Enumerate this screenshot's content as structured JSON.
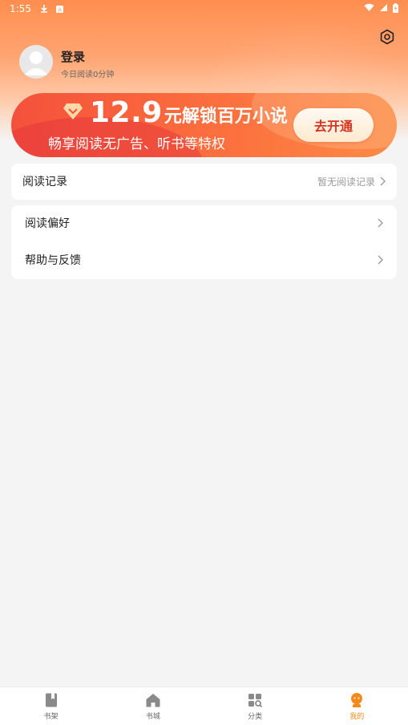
{
  "status_bar": {
    "time": "1:55",
    "icons": [
      "download-icon",
      "notification-icon",
      "wifi-icon",
      "signal-icon",
      "battery-icon"
    ]
  },
  "profile": {
    "login_label": "登录",
    "read_time": "今日阅读0分钟"
  },
  "vip": {
    "price": "12.9",
    "unlock_text": "元解锁百万小说",
    "subtitle": "畅享阅读无广告、听书等特权",
    "cta": "去开通"
  },
  "reading_record": {
    "label": "阅读记录",
    "status": "暂无阅读记录"
  },
  "menu": {
    "items": [
      {
        "label": "阅读偏好"
      },
      {
        "label": "帮助与反馈"
      }
    ]
  },
  "bottom_nav": {
    "items": [
      {
        "label": "书架",
        "icon": "bookshelf-icon"
      },
      {
        "label": "书城",
        "icon": "home-icon"
      },
      {
        "label": "分类",
        "icon": "category-icon"
      },
      {
        "label": "我的",
        "icon": "profile-icon"
      }
    ],
    "active_index": 3
  },
  "colors": {
    "header_orange": "#ff8e4f",
    "vip_red": "#f4513c",
    "cta_text": "#d8341f",
    "nav_active": "#f38b1c",
    "background": "#f4f4f4"
  }
}
